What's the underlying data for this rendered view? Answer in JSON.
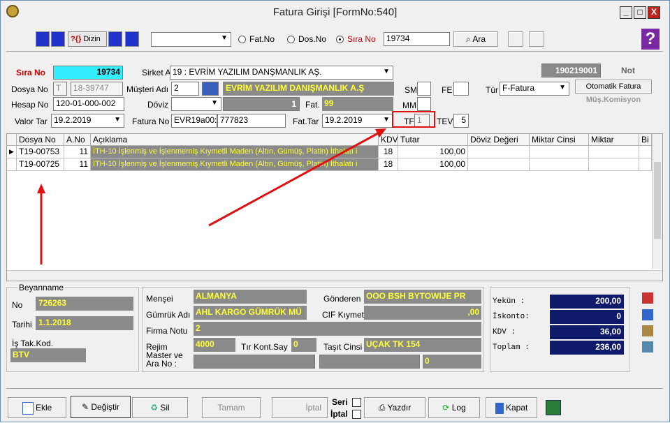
{
  "window": {
    "title": "Fatura Girişi [FormNo:540]",
    "min": "_",
    "max": "□",
    "close": "X"
  },
  "toolbar": {
    "dizin": "Dizin",
    "fatno": "Fat.No",
    "dosno": "Dos.No",
    "sirano": "Sıra No",
    "search_value": "19734",
    "ara": "Ara",
    "help": "?"
  },
  "header": {
    "sira_no_label": "Sıra No",
    "sira_no": "19734",
    "sirket_adi_label": "Sirket Adı",
    "sirket_adi": "19 : EVRİM YAZILIM DANŞMANLIK AŞ.",
    "record_code": "190219001",
    "not_label": "Not",
    "dosya_no_label": "Dosya No",
    "dosya_no_t": "T",
    "dosya_no": "18-39747",
    "musteri_adi_label": "Müşteri Adı",
    "musteri_no": "2",
    "musteri_adi": "EVRİM YAZILIM DANIŞMANLIK A.Ş",
    "sm_label": "SM",
    "fe_label": "FE",
    "tur_label": "Tür",
    "tur": "F-Fatura",
    "otomatik_fatura": "Otomatik Fatura",
    "mus_komisyon": "Müş.Komisyon",
    "hesap_no_label": "Hesap No",
    "hesap_no": "120-01-000-002",
    "doviz_label": "Döviz",
    "doviz_rate": "1",
    "fat_say_label": "Fat. Say",
    "fat_say": "99",
    "mm_label": "MM",
    "valor_tar_label": "Valor Tar",
    "valor_tar": "19.2.2019",
    "fatura_no_label": "Fatura No",
    "fatura_no_1": "EVR19a00:0",
    "fatura_no_2": "777823",
    "fat_tar_label": "Fat.Tar",
    "fat_tar": "19.2.2019",
    "tf_label": "TF",
    "tf": "1",
    "tev_label": "TEV",
    "tev": "5"
  },
  "grid": {
    "columns": [
      "Dosya No",
      "A.No",
      "Açıklama",
      "KDV",
      "Tutar",
      "Döviz Değeri",
      "Miktar Cinsi",
      "Miktar",
      "Bi"
    ],
    "rows": [
      {
        "dosya_no": "T19-00753",
        "a_no": "11",
        "aciklama": "İTH-10 İşlenmiş ve İşlenmemiş Kıymetli Maden (Altın, Gümüş, Platin) İthalatı i",
        "kdv": "18",
        "tutar": "100,00"
      },
      {
        "dosya_no": "T19-00725",
        "a_no": "11",
        "aciklama": "İTH-10 İşlenmiş ve İşlenmemiş Kıymetli Maden (Altın, Gümüş, Platin) İthalatı i",
        "kdv": "18",
        "tutar": "100,00"
      }
    ]
  },
  "beyanname": {
    "title": "Beyanname",
    "no_label": "No",
    "no": "726263",
    "tarihi_label": "Tarihi",
    "tarihi": "1.1.2018",
    "is_tak_label": "İş Tak.Kod.",
    "is_tak": "BTV"
  },
  "details": {
    "mensei_label": "Menşei",
    "mensei": "ALMANYA",
    "gonderen_label": "Gönderen",
    "gonderen": "OOO BSH BYTOWIJE PR",
    "gumruk_label": "Gümrük Adı",
    "gumruk": "AHL KARGO GÜMRÜK MÜ",
    "cif_label": "CIF Kıymet",
    "cif": ",00",
    "firma_notu_label": "Firma Notu",
    "firma_notu": "2",
    "rejim_label": "Rejim",
    "rejim": "4000",
    "tir_label": "Tır Kont.Say",
    "tir": "0",
    "tasit_label": "Taşıt Cinsi",
    "tasit": "UÇAK TK 154",
    "master_label": "Master ve Ara No :",
    "master_val": "0"
  },
  "totals": {
    "yekun_label": "Yekün   :",
    "yekun": "200,00",
    "iskonto_label": "İskonto:",
    "iskonto": "0",
    "kdv_label": "KDV     :",
    "kdv": "36,00",
    "toplam_label": "Toplam  :",
    "toplam": "236,00"
  },
  "buttons": {
    "ekle": "Ekle",
    "degistir": "Değiştir",
    "sil": "Sil",
    "tamam": "Tamam",
    "iptal": "İptal",
    "seri": "Seri",
    "iptal2": "İptal",
    "yazdir": "Yazdır",
    "log": "Log",
    "kapat": "Kapat"
  },
  "colors": {
    "accent_cyan": "#33eeff",
    "yellow": "#ffff33",
    "navy": "#101a6b",
    "red": "#e01010"
  }
}
